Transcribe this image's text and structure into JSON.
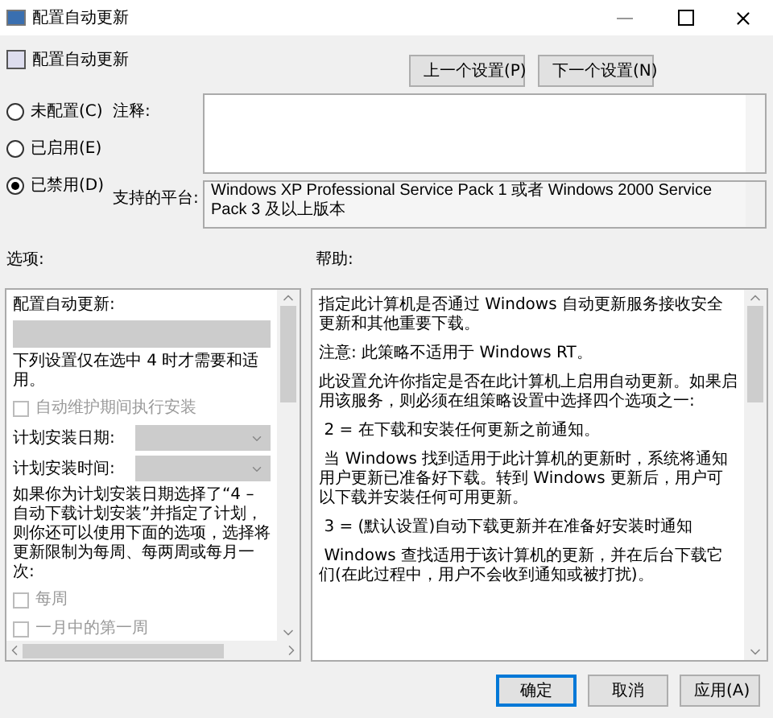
{
  "window": {
    "title": "配置自动更新"
  },
  "header": {
    "title": "配置自动更新",
    "buttons": [
      "上一个设置(P)",
      "下一个设置(N)"
    ]
  },
  "state_options": [
    {
      "label": "未配置(C)",
      "selected": false
    },
    {
      "label": "已启用(E)",
      "selected": false
    },
    {
      "label": "已禁用(D)",
      "selected": true
    }
  ],
  "comment": {
    "label": "注释:"
  },
  "platform": {
    "label": "支持的平台:",
    "text": "Windows XP Professional Service Pack 1 或者 Windows 2000 Service Pack 3 及以上版本"
  },
  "options": {
    "label": "选项:",
    "items": [
      {
        "kind": "text",
        "label": "配置自动更新:"
      },
      {
        "kind": "field",
        "disabled": true
      },
      {
        "kind": "text",
        "label": "下列设置仅在选中 4 时才需要和适用。"
      },
      {
        "kind": "checkbox",
        "label": "自动维护期间执行安装",
        "checked": false,
        "disabled": true
      },
      {
        "kind": "dropdown",
        "label": "计划安装日期:",
        "disabled": true
      },
      {
        "kind": "dropdown",
        "label": "计划安装时间:",
        "disabled": true
      },
      {
        "kind": "text",
        "label": "如果你为计划安装日期选择了“4 – 自动下载计划安装”并指定了计划，则你还可以使用下面的选项，选择将更新限制为每周、每两周或每月一次:"
      },
      {
        "kind": "checkbox",
        "label": "每周",
        "checked": false,
        "disabled": true
      },
      {
        "kind": "checkbox",
        "label": "一月中的第一周",
        "checked": false,
        "disabled": true
      }
    ]
  },
  "help": {
    "label": "帮助:",
    "paragraphs": [
      "指定此计算机是否通过 Windows 自动更新服务接收安全更新和其他重要下载。",
      "注意: 此策略不适用于 Windows RT。",
      "此设置允许你指定是否在此计算机上启用自动更新。如果启用该服务，则必须在组策略设置中选择四个选项之一:",
      " 2 = 在下载和安装任何更新之前通知。",
      " 当 Windows 找到适用于此计算机的更新时，系统将通知用户更新已准备好下载。转到 Windows 更新后，用户可以下载并安装任何可用更新。",
      " 3 = (默认设置)自动下载更新并在准备好安装时通知",
      " Windows 查找适用于该计算机的更新，并在后台下载它们(在此过程中，用户不会收到通知或被打扰)。"
    ]
  },
  "footer": {
    "buttons": [
      {
        "label": "确定",
        "selected": true
      },
      {
        "label": "取消",
        "selected": false
      },
      {
        "label": "应用(A)",
        "selected": false
      }
    ]
  }
}
